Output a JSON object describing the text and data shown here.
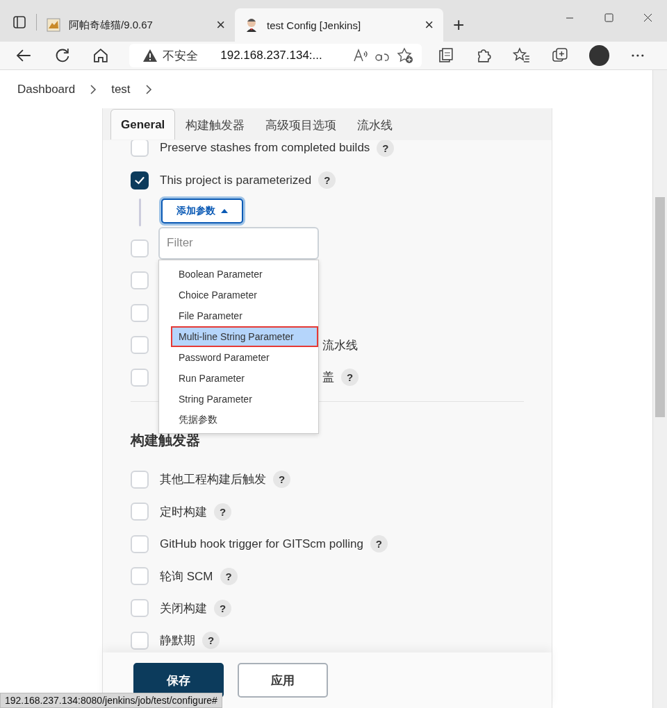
{
  "browser": {
    "tabs": [
      {
        "title": "阿帕奇雄猫/9.0.67",
        "selected": false,
        "close": "×"
      },
      {
        "title": "test Config [Jenkins]",
        "selected": true,
        "close": "×"
      }
    ],
    "new_tab": "+",
    "address": {
      "security": "不安全",
      "url": "192.168.237.134:..."
    }
  },
  "breadcrumb": [
    {
      "label": "Dashboard"
    },
    {
      "label": "test"
    }
  ],
  "tabs": [
    {
      "label": "General",
      "selected": true
    },
    {
      "label": "构建触发器",
      "selected": false
    },
    {
      "label": "高级项目选项",
      "selected": false
    },
    {
      "label": "流水线",
      "selected": false
    }
  ],
  "general": [
    {
      "kind": "checkbox",
      "label": "Preserve stashes from completed builds",
      "checked": false,
      "help": "?"
    },
    {
      "kind": "checkbox",
      "label": "This project is parameterized",
      "checked": true,
      "help": "?"
    },
    {
      "kind": "add",
      "label": "添加参数"
    },
    {
      "kind": "checkbox",
      "checked": false
    },
    {
      "kind": "checkbox",
      "checked": false
    },
    {
      "kind": "checkbox",
      "checked": false
    },
    {
      "kind": "checkbox",
      "checked": false,
      "tail": "流水线"
    },
    {
      "kind": "checkbox",
      "checked": false,
      "tail": "盖",
      "help": "?"
    }
  ],
  "param_menu": {
    "filter_placeholder": "Filter",
    "items": [
      {
        "label": "Boolean Parameter",
        "selected": false,
        "outlined": false
      },
      {
        "label": "Choice Parameter",
        "selected": false,
        "outlined": false
      },
      {
        "label": "File Parameter",
        "selected": false,
        "outlined": false
      },
      {
        "label": "Multi-line String Parameter",
        "selected": true,
        "outlined": true
      },
      {
        "label": "Password Parameter",
        "selected": false,
        "outlined": false
      },
      {
        "label": "Run Parameter",
        "selected": false,
        "outlined": false
      },
      {
        "label": "String Parameter",
        "selected": false,
        "outlined": false
      },
      {
        "label": "凭据参数",
        "selected": false,
        "outlined": false
      }
    ]
  },
  "triggers": {
    "heading": "构建触发器",
    "rows": [
      {
        "kind": "checkbox",
        "label": "其他工程构建后触发",
        "checked": false,
        "help": "?"
      },
      {
        "kind": "checkbox",
        "label": "定时构建",
        "checked": false,
        "help": "?"
      },
      {
        "kind": "checkbox",
        "label": "GitHub hook trigger for GITScm polling",
        "checked": false,
        "help": "?"
      },
      {
        "kind": "checkbox",
        "label": "轮询 SCM",
        "checked": false,
        "help": "?"
      },
      {
        "kind": "checkbox",
        "label": "关闭构建",
        "checked": false,
        "help": "?"
      },
      {
        "kind": "checkbox",
        "label": "静默期",
        "checked": false,
        "help": "?"
      }
    ]
  },
  "footer": {
    "buttons": [
      {
        "label": "保存",
        "kind": "primary"
      },
      {
        "label": "应用",
        "kind": "secondary"
      }
    ]
  },
  "status_bar": "192.168.237.134:8080/jenkins/job/test/configure#"
}
